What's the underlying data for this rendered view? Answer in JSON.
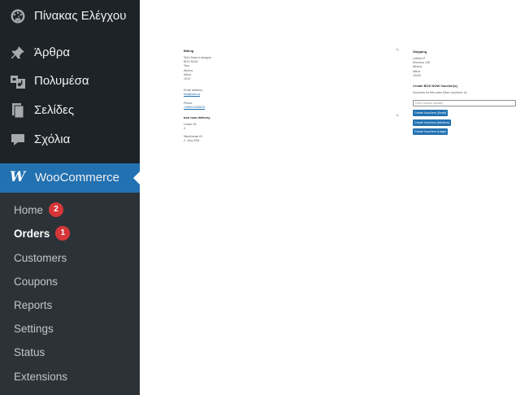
{
  "sidebar": {
    "items": [
      {
        "label": "Πίνακας Ελέγχου",
        "icon": "dashboard-icon"
      },
      {
        "label": "Άρθρα",
        "icon": "pin-icon"
      },
      {
        "label": "Πολυμέσα",
        "icon": "media-icon"
      },
      {
        "label": "Σελίδες",
        "icon": "pages-icon"
      },
      {
        "label": "Σχόλια",
        "icon": "comments-icon"
      }
    ],
    "woocommerce": {
      "label": "WooCommerce",
      "logo": "W"
    },
    "submenu": [
      {
        "label": "Home",
        "badge": "2"
      },
      {
        "label": "Orders",
        "badge": "1"
      },
      {
        "label": "Customers"
      },
      {
        "label": "Coupons"
      },
      {
        "label": "Reports"
      },
      {
        "label": "Settings"
      },
      {
        "label": "Status"
      },
      {
        "label": "Extensions"
      }
    ],
    "colors": {
      "bg": "#1d2327",
      "submenu_bg": "#2c3338",
      "accent": "#2271b1",
      "badge": "#d63638"
    }
  },
  "billing": {
    "title": "Billing",
    "address_lines": [
      "Tech Team e-shoppin",
      "BOX NOW",
      "Test",
      "Athens",
      "Attica",
      "1019"
    ],
    "email_label": "Email address:",
    "email": "test@test.ca",
    "phone_label": "Phone:",
    "phone": "+306912345678"
  },
  "boxnow": {
    "title": "box now delivery",
    "locker_label": "Locker ID:",
    "locker_value": "4",
    "warehouse_label": "Warehouse ID:",
    "warehouse_value": "2 - Any ATM"
  },
  "shipping": {
    "title": "Shipping",
    "address_lines": [
      "Lefteris P",
      "Kimonos 136",
      "Athens",
      "Attica",
      "10443"
    ]
  },
  "vouchers": {
    "title": "Create BOX NOW Voucher(s)",
    "subtitle": "Vouchers for this order (Max Vouchers: 5):",
    "input_placeholder": "Enter voucher quantity",
    "buttons": [
      "Create Vouchers (Small)",
      "Create Vouchers (Medium)",
      "Create Vouchers (Large)"
    ]
  }
}
